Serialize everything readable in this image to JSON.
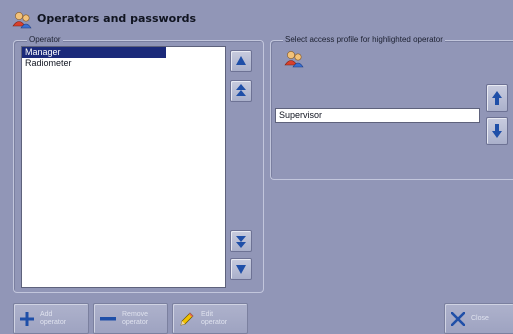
{
  "window": {
    "title": "Operators and passwords",
    "title_icon": "operators-icon"
  },
  "operator_group": {
    "legend": "Operator",
    "items": [
      {
        "label": "Manager",
        "selected": true
      },
      {
        "label": "Radiometer",
        "selected": false
      }
    ]
  },
  "access_group": {
    "legend": "Select access profile for highlighted operator",
    "profile_icon": "operators-icon",
    "profile_value": "Supervisor"
  },
  "buttons": {
    "add_line1": "Add",
    "add_line2": "operator",
    "remove_line1": "Remove",
    "remove_line2": "operator",
    "edit_line1": "Edit",
    "edit_line2": "operator",
    "close": "Close"
  },
  "colors": {
    "background": "#9196b7",
    "selection": "#1b2a7a",
    "arrow_blue": "#1f4fa8"
  }
}
